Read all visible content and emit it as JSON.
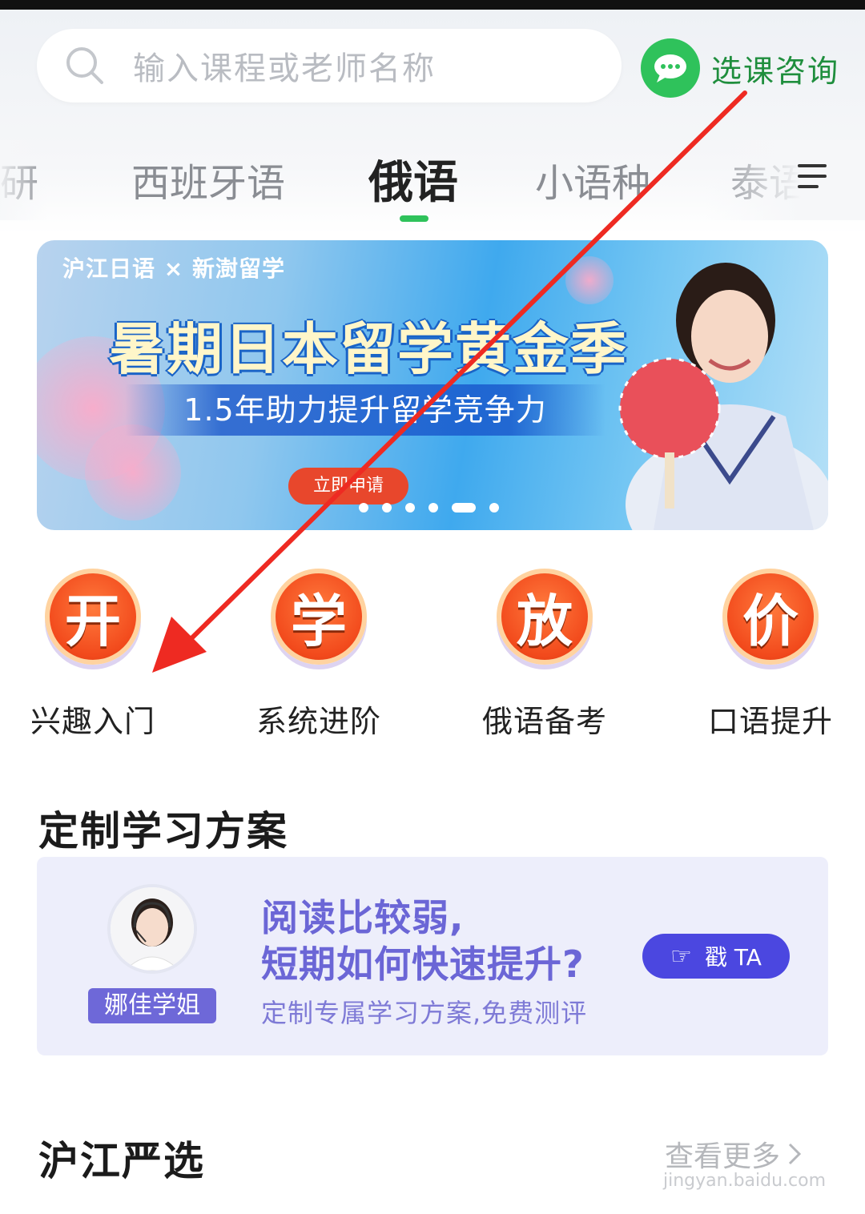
{
  "search": {
    "placeholder": "输入课程或老师名称"
  },
  "consult": {
    "label": "选课咨询"
  },
  "tabs": [
    {
      "label": "考研"
    },
    {
      "label": "西班牙语"
    },
    {
      "label": "俄语"
    },
    {
      "label": "小语种"
    },
    {
      "label": "泰语"
    }
  ],
  "banner": {
    "brand": "沪江日语 × 新澍留学",
    "headline": "暑期日本留学黄金季",
    "subtitle": "1.5年助力提升留学竞争力",
    "cta": "立即申请",
    "slide_count": 6,
    "active_slide": 5
  },
  "quick_entries": [
    {
      "badge": "开",
      "label": "兴趣入门"
    },
    {
      "badge": "学",
      "label": "系统进阶"
    },
    {
      "badge": "放",
      "label": "俄语备考"
    },
    {
      "badge": "价",
      "label": "口语提升"
    }
  ],
  "plan_section": {
    "title": "定制学习方案",
    "advisor_name": "娜佳学姐",
    "question_line1": "阅读比较弱,",
    "question_line2": "短期如何快速提升?",
    "description": "定制专属学习方案,免费测评",
    "button": "戳 TA"
  },
  "selection_section": {
    "title": "沪江严选",
    "more": "查看更多"
  },
  "watermark": "jingyan.baidu.com",
  "colors": {
    "accent_green": "#2fc25b",
    "annotation_arrow": "#ee2a22",
    "plan_purple": "#6b66d6"
  }
}
